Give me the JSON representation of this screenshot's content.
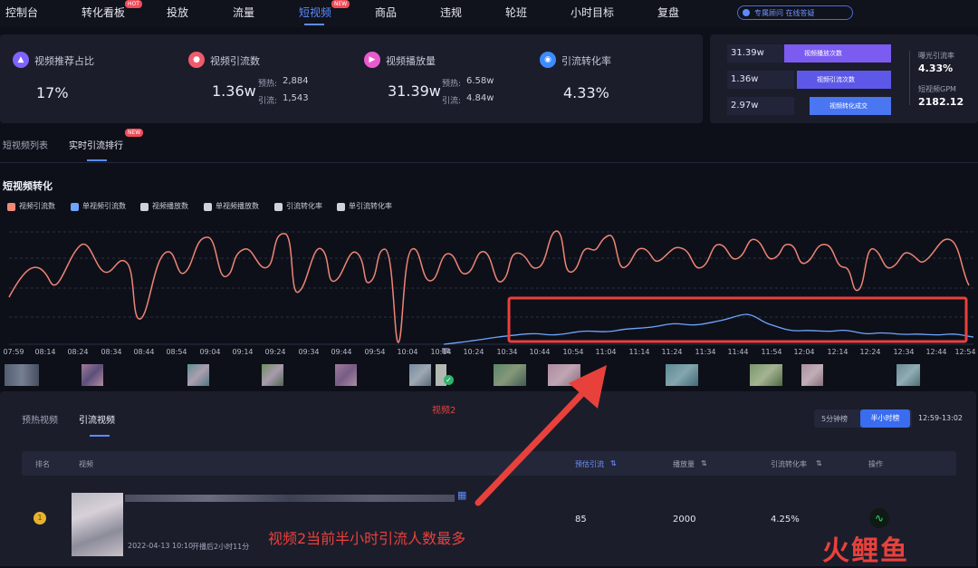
{
  "nav": {
    "items": [
      "控制台",
      "转化看板",
      "投放",
      "流量",
      "短视频",
      "商品",
      "违规",
      "轮班",
      "小时目标",
      "复盘"
    ],
    "badge_hot": "HOT",
    "badge_new": "NEW",
    "pill": "专属顾问 在线答疑"
  },
  "kpis": [
    {
      "label": "视频推荐占比",
      "value": "17%",
      "icon": "thumbs-up-icon",
      "color": "#7f62ff"
    },
    {
      "label": "视频引流数",
      "value": "1.36w",
      "icon": "user-icon",
      "color": "#f05b6d",
      "sub1_label": "预热:",
      "sub1_val": "2,884",
      "sub2_label": "引流:",
      "sub2_val": "1,543"
    },
    {
      "label": "视频播放量",
      "value": "31.39w",
      "icon": "play-icon",
      "color": "#e85bcf",
      "sub1_label": "预热:",
      "sub1_val": "6.58w",
      "sub2_label": "引流:",
      "sub2_val": "4.84w"
    },
    {
      "label": "引流转化率",
      "value": "4.33%",
      "icon": "people-icon",
      "color": "#3c8bff"
    }
  ],
  "funnel": {
    "rows": [
      {
        "value": "31.39w",
        "label": "视频播放次数",
        "color": "#7b5bf0"
      },
      {
        "value": "1.36w",
        "label": "视频引流次数",
        "color": "#5d58e8"
      },
      {
        "value": "2.97w",
        "label": "视频转化成交",
        "color": "#4a76f2"
      }
    ],
    "stat1_label": "曝光引流率",
    "stat1_value": "4.33%",
    "stat2_label": "短视频GPM",
    "stat2_value": "2182.12"
  },
  "subtabs": [
    "短视频列表",
    "实时引流排行"
  ],
  "section_title": "短视频转化",
  "legend": [
    {
      "label": "视频引流数",
      "color": "#f08a78"
    },
    {
      "label": "单视频引流数",
      "color": "#6ea6ff"
    },
    {
      "label": "视频播放数",
      "color": "#cfd1dc"
    },
    {
      "label": "单视频播放数",
      "color": "#cfd1dc"
    },
    {
      "label": "引流转化率",
      "color": "#cfd1dc"
    },
    {
      "label": "单引流转化率",
      "color": "#cfd1dc"
    }
  ],
  "ticks": [
    "07:59",
    "08:14",
    "08:24",
    "08:34",
    "08:44",
    "08:54",
    "09:04",
    "09:14",
    "09:24",
    "09:34",
    "09:44",
    "09:54",
    "10:04",
    "10:14",
    "10:24",
    "10:34",
    "10:44",
    "10:54",
    "11:04",
    "11:14",
    "11:24",
    "11:34",
    "11:44",
    "11:54",
    "12:04",
    "12:14",
    "12:24",
    "12:34",
    "12:44",
    "12:54"
  ],
  "annot": {
    "video2": "视频2",
    "caption": "视频2当前半小时引流人数最多"
  },
  "bottom": {
    "tabs": [
      "预热视频",
      "引流视频"
    ],
    "btn_5min": "5分钟榜",
    "btn_30min": "半小时榜",
    "time_range": "12:59-13:02",
    "headers": [
      "排名",
      "视频",
      "预估引流",
      "播放量",
      "引流转化率",
      "操作"
    ],
    "row": {
      "date": "2022-04-13 10:10",
      "after": "开播后2小时11分",
      "traffic": "85",
      "plays": "2000",
      "rate": "4.25%"
    }
  },
  "watermark": "火鲤鱼"
}
